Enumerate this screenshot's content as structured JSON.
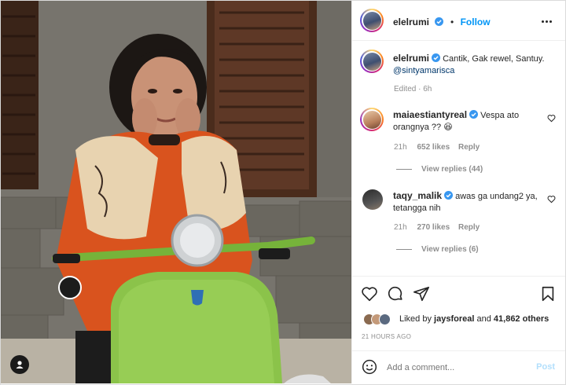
{
  "post": {
    "username": "elelrumi",
    "follow_label": "Follow",
    "separator": "•",
    "caption_text": "Cantik, Gak rewel, Santuy.",
    "caption_mention": "@sintyamarisca",
    "edited": "Edited · 6h"
  },
  "comments": [
    {
      "username": "maiaestiantyreal",
      "text_line1": "Vespa ato",
      "text_line2": "orangnya ?? ",
      "emoji": "😆",
      "time": "21h",
      "likes": "652 likes",
      "reply": "Reply",
      "view_replies": "View replies (44)"
    },
    {
      "username": "taqy_malik",
      "text_line1": "awas ga undang2 ya,",
      "text_line2": "tetangga nih",
      "time": "21h",
      "likes": "270 likes",
      "reply": "Reply",
      "view_replies": "View replies (6)"
    }
  ],
  "likes": {
    "prefix": "Liked by",
    "user": "jaysforeal",
    "and": "and",
    "others": "41,862 others",
    "timestamp": "21 HOURS AGO"
  },
  "composer": {
    "placeholder": "Add a comment...",
    "post_label": "Post"
  },
  "icons": [
    "verified-badge-icon",
    "more-options-icon",
    "heart-icon",
    "comment-icon",
    "share-icon",
    "bookmark-icon",
    "emoji-icon",
    "user-tag-icon"
  ],
  "colors": {
    "link_blue": "#0095f6",
    "mention": "#00376b",
    "muted": "#8e8e8e",
    "scooter_green": "#8bc34a",
    "jacket_orange": "#d9531e"
  }
}
